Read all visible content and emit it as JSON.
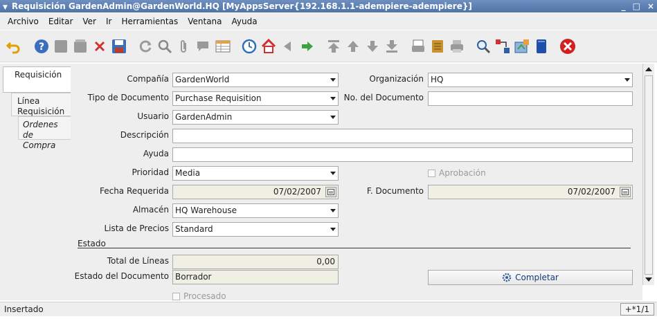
{
  "window": {
    "title": "Requisición  GardenAdmin@GardenWorld.HQ [MyAppsServer{192.168.1.1-adempiere-adempiere}]",
    "controls": [
      "_",
      "□",
      "×"
    ]
  },
  "menu": [
    "Archivo",
    "Editar",
    "Ver",
    "Ir",
    "Herramientas",
    "Ventana",
    "Ayuda"
  ],
  "tabs": {
    "active": "Requisición",
    "linea_l1": "Línea",
    "linea_l2": "Requisición",
    "ordenes_l1": "Ordenes",
    "ordenes_l2": "de Compra"
  },
  "form": {
    "compania": {
      "label": "Compañía",
      "value": "GardenWorld"
    },
    "organizacion": {
      "label": "Organización",
      "value": "HQ"
    },
    "tipo_doc": {
      "label": "Tipo de Documento",
      "value": "Purchase Requisition"
    },
    "no_doc": {
      "label": "No. del Documento",
      "value": ""
    },
    "usuario": {
      "label": "Usuario",
      "value": "GardenAdmin"
    },
    "descripcion": {
      "label": "Descripción",
      "value": ""
    },
    "ayuda": {
      "label": "Ayuda",
      "value": ""
    },
    "prioridad": {
      "label": "Prioridad",
      "value": "Media"
    },
    "aprobacion": {
      "label": "Aprobación",
      "checked": false
    },
    "fecha_requerida": {
      "label": "Fecha Requerida",
      "value": "07/02/2007"
    },
    "f_documento": {
      "label": "F. Documento",
      "value": "07/02/2007"
    },
    "almacen": {
      "label": "Almacén",
      "value": "HQ Warehouse"
    },
    "lista_precios": {
      "label": "Lista de Precios",
      "value": "Standard"
    },
    "section_estado": "Estado",
    "total_lineas": {
      "label": "Total de Líneas",
      "value": "0,00"
    },
    "estado_doc": {
      "label": "Estado del Documento",
      "value": "Borrador"
    },
    "completar": {
      "label": "Completar"
    },
    "procesado": {
      "label": "Procesado",
      "checked": false
    }
  },
  "status": {
    "text": "Insertado",
    "record": "+*1/1"
  },
  "colors": {
    "title_bar": "#4f74a8",
    "readonly_bg": "#f0efe4",
    "accent": "#123a7a"
  }
}
